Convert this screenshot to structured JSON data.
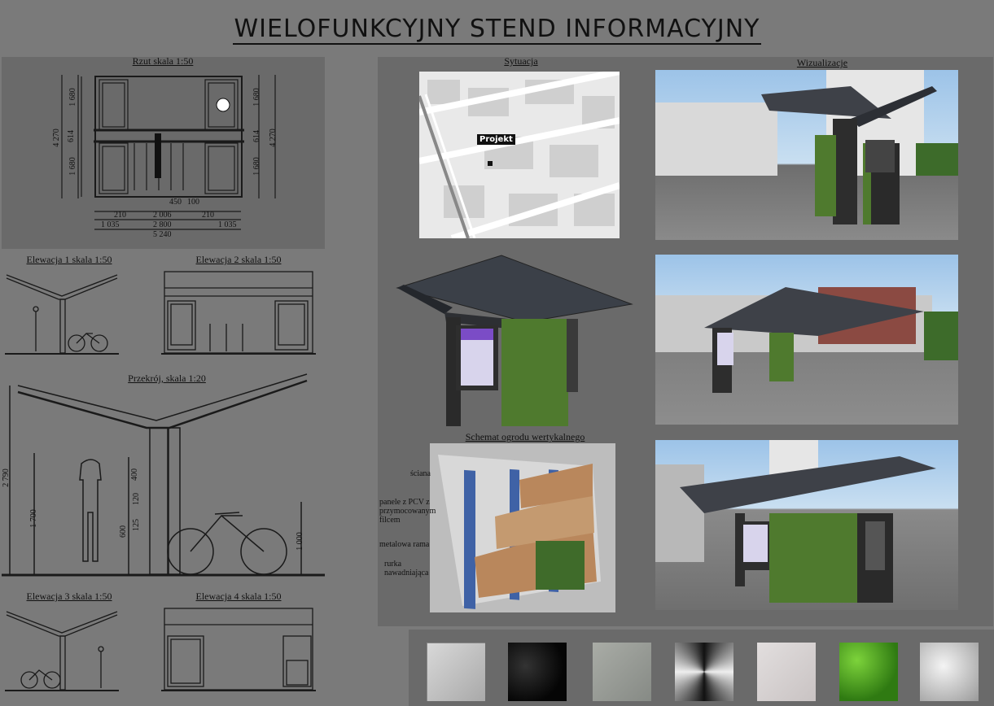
{
  "title": "WIELOFUNKCYJNY  STEND  INFORMACYJNY",
  "labels": {
    "rzut": "Rzut  skala 1:50",
    "sytuacja": "Sytuacja",
    "wizualizacje": "Wizualizacje",
    "elewacja1": "Elewacja 1 skala  1:50",
    "elewacja2": "Elewacja 2 skala 1:50",
    "przekroj": "Przekrój, skala 1:20",
    "elewacja3": "Elewacja 3 skala 1:50",
    "elewacja4": "Elewacja 4 skala 1:50",
    "schemat": "Schemat ogrodu wertykalnego"
  },
  "rzut_dims": {
    "left_top": "1 680",
    "left_mid": "614",
    "left_bot": "1 680",
    "left_total": "4 270",
    "right_top": "1 680",
    "right_mid": "614",
    "right_bot": "1 680",
    "right_total": "4 270",
    "d450": "450",
    "d100": "100",
    "d210a": "210",
    "d2006": "2 006",
    "d210b": "210",
    "d1035a": "1 035",
    "d2800": "2 800",
    "d1035b": "1 035",
    "d5240": "5 240"
  },
  "przekroj_dims": {
    "h2790": "2 790",
    "h1700": "1 700",
    "h400": "400",
    "h120": "120",
    "h600": "600",
    "h125": "125",
    "h1000": "1 000"
  },
  "map": {
    "projekt_label": "Projekt"
  },
  "schemat_annotations": {
    "sciana": "ściana",
    "panele": "panele z PCV z przymocowanym filcem",
    "rama": "metalowa rama",
    "rurka": "rurka nawadniająca"
  },
  "colors": {
    "background": "#7a7a7a",
    "panel": "#6a6a6a",
    "line": "#1a1a1a",
    "green": "#4f7a2e"
  },
  "materials": [
    "grey-panel-tile",
    "black-marble-tile",
    "concrete-tile",
    "metal-radial-tile",
    "light-marble-tile",
    "green-leaves-tile",
    "silver-gradient-tile"
  ]
}
